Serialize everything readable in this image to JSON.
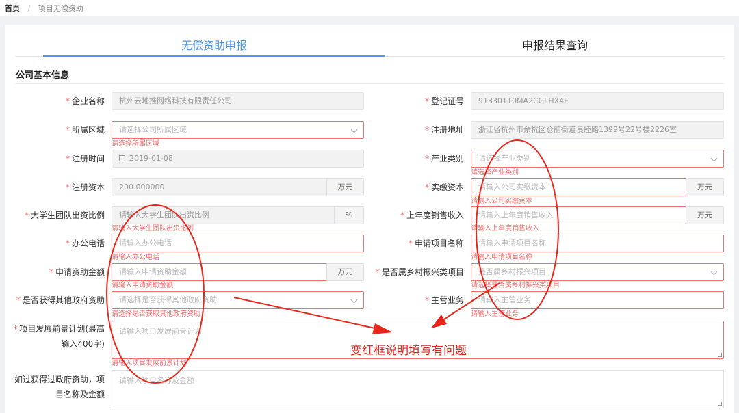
{
  "breadcrumb": {
    "home": "首页",
    "separator": "/",
    "current": "项目无偿资助"
  },
  "tabs": {
    "active": "无偿资助申报",
    "inactive": "申报结果查询"
  },
  "section_title": "公司基本信息",
  "required_mark": "*",
  "fields": {
    "company_name": {
      "label": "企业名称",
      "value": "杭州云地推网络科技有限责任公司"
    },
    "reg_number": {
      "label": "登记证号",
      "value": "91330110MA2CGLHX4E"
    },
    "region": {
      "label": "所属区域",
      "placeholder": "请选择公司所属区域",
      "error": "请选择所属区域"
    },
    "reg_address": {
      "label": "注册地址",
      "value": "浙江省杭州市余杭区仓前街道良睦路1399号22号楼2226室"
    },
    "reg_date": {
      "label": "注册时间",
      "value": "2019-01-08"
    },
    "industry": {
      "label": "产业类别",
      "placeholder": "请选择产业类别",
      "error": "请选择产业类别"
    },
    "reg_capital": {
      "label": "注册资本",
      "value": "200.000000",
      "unit": "万元"
    },
    "paid_capital": {
      "label": "实缴资本",
      "placeholder": "请输入公司实缴资本",
      "unit": "万元",
      "error": "请输入公司实缴资本"
    },
    "student_ratio": {
      "label": "大学生团队出资比例",
      "placeholder": "请输入大学生团队出资比例",
      "unit": "%",
      "error": "请输入大学生团队出资比例"
    },
    "last_year_sales": {
      "label": "上年度销售收入",
      "placeholder": "请输入上年度销售收入",
      "unit": "万元",
      "error": "请输入上年度销售收入"
    },
    "office_phone": {
      "label": "办公电话",
      "placeholder": "请输入办公电话",
      "error": "请输入办公电话"
    },
    "project_name": {
      "label": "申请项目名称",
      "placeholder": "请输入申请项目名称",
      "error": "请输入申请项目名称"
    },
    "funding_amount": {
      "label": "申请资助金额",
      "placeholder": "请输入申请资助金额",
      "unit": "万元",
      "error": "请输入申请资助金额"
    },
    "rural_project": {
      "label": "是否属乡村振兴类项目",
      "placeholder": "是否属乡村振兴项目",
      "error": "请选择是否属乡村振兴类项目"
    },
    "other_funding": {
      "label": "是否获得其他政府资助",
      "placeholder": "请选择是否获得其他政府资助",
      "error": "请选择是否获取其他政府资助"
    },
    "main_business": {
      "label": "主营业务",
      "placeholder": "请输入主营业务",
      "error": "请输入主营业务"
    },
    "dev_plan": {
      "label_line1": "项目发展前景计划(最高",
      "label_line2": "输入400字)",
      "placeholder": "请输入项目发展前景计划",
      "error": "请输入项目发展前景计划"
    },
    "past_funding": {
      "label_line1": "如过获得过政府资助，项",
      "label_line2": "目名称及金额",
      "placeholder": "请输入项目名称及金额"
    }
  },
  "annotation": {
    "text": "变红框说明填写有问题",
    "color": "#e8261b"
  }
}
